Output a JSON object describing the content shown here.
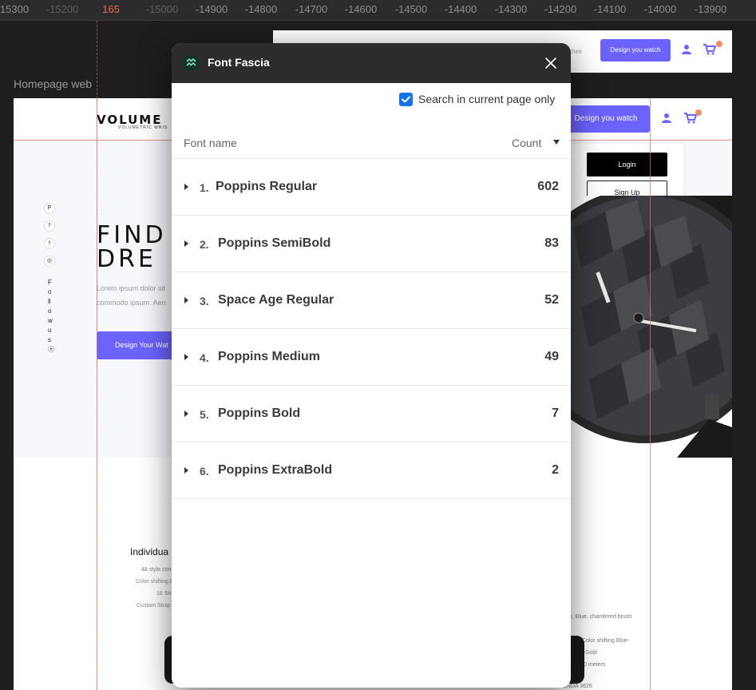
{
  "ruler": {
    "labels": [
      "15300",
      "-15200",
      "165",
      "-15000",
      "-14900",
      "-14800",
      "-14700",
      "-14600",
      "-14500",
      "-14400",
      "-14300",
      "-14200",
      "-14100",
      "-14000",
      "-13900"
    ]
  },
  "canvas": {
    "frame_label": "Homepage web",
    "logo_text": "VOLUME",
    "logo_subtext": "VOLUMETRIC WRIS",
    "social_icons": [
      "P",
      "f",
      "t",
      "◎"
    ],
    "vertical_text": "Follow us ⓔ",
    "hero_title_line1": "FIND",
    "hero_title_line2": "DRE",
    "hero_text_line1": "Lorem ipsum dolor sit",
    "hero_text_line2": "commodo ipsum. Aen",
    "hero_button": "Design Your Wat",
    "top_link": "ches",
    "top_button": "Design you watch",
    "header_button": "Design you watch",
    "login_button": "Login",
    "signup_button": "Sign Up",
    "section_title": "Individua",
    "features_left": [
      "48 style com",
      "Color shifting D",
      "16 Str",
      "Custom Strap"
    ],
    "features_right": [
      "ack, Blue, chamfered brush",
      "Color shifting Blue-",
      "Gold",
      "0 meters",
      "ft   Silicon  Fabric  BONDA  3626"
    ]
  },
  "dialog": {
    "title": "Font Fascia",
    "search_label": "Search in current page only",
    "search_checked": true,
    "col_name": "Font name",
    "col_count": "Count",
    "accent_color": "#1473e6",
    "fonts": [
      {
        "index": "1.",
        "name": "Poppins Regular",
        "count": "602"
      },
      {
        "index": "2.",
        "name": "Poppins SemiBold",
        "count": "83"
      },
      {
        "index": "3.",
        "name": "Space Age Regular",
        "count": "52"
      },
      {
        "index": "4.",
        "name": "Poppins Medium",
        "count": "49"
      },
      {
        "index": "5.",
        "name": "Poppins Bold",
        "count": "7"
      },
      {
        "index": "6.",
        "name": "Poppins ExtraBold",
        "count": "2"
      }
    ]
  }
}
